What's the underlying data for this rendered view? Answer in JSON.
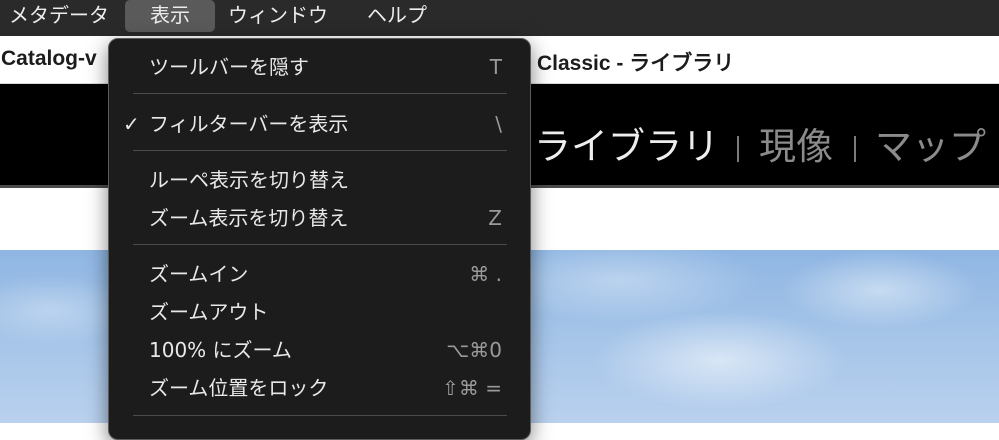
{
  "menubar": {
    "items": [
      {
        "label": "メタデータ"
      },
      {
        "label": "表示"
      },
      {
        "label": "ウィンドウ"
      },
      {
        "label": "ヘルプ"
      }
    ]
  },
  "window": {
    "title_left": "Catalog-v",
    "title_right": "Classic - ライブラリ"
  },
  "modules": {
    "items": [
      {
        "label": "ライブラリ",
        "active": true
      },
      {
        "label": "現像",
        "active": false
      },
      {
        "label": "マップ",
        "active": false
      }
    ]
  },
  "view_menu": {
    "items": [
      {
        "label": "ツールバーを隠す",
        "shortcut": "T",
        "checked": false
      },
      {
        "label": "フィルターバーを表示",
        "shortcut": "\\",
        "checked": true,
        "check_mark": "✓"
      },
      {
        "label": "ルーペ表示を切り替え",
        "shortcut": "",
        "checked": false
      },
      {
        "label": "ズーム表示を切り替え",
        "shortcut": "Z",
        "checked": false
      },
      {
        "label": "ズームイン",
        "shortcut": "⌘ .",
        "checked": false
      },
      {
        "label": "ズームアウト",
        "shortcut": "",
        "checked": false
      },
      {
        "label": "100% にズーム",
        "shortcut": "⌥⌘0",
        "checked": false
      },
      {
        "label": "ズーム位置をロック",
        "shortcut": "⇧⌘ =",
        "checked": false
      }
    ]
  },
  "colors": {
    "menubar_bg": "#2a2a2a",
    "menu_bg": "#1c1c1c",
    "menu_text": "#e8e8e8",
    "shortcut_text": "#9a9a9a",
    "module_active": "#eeeeee",
    "module_inactive": "#8b8b8b",
    "sky": "#a3c3e8"
  }
}
